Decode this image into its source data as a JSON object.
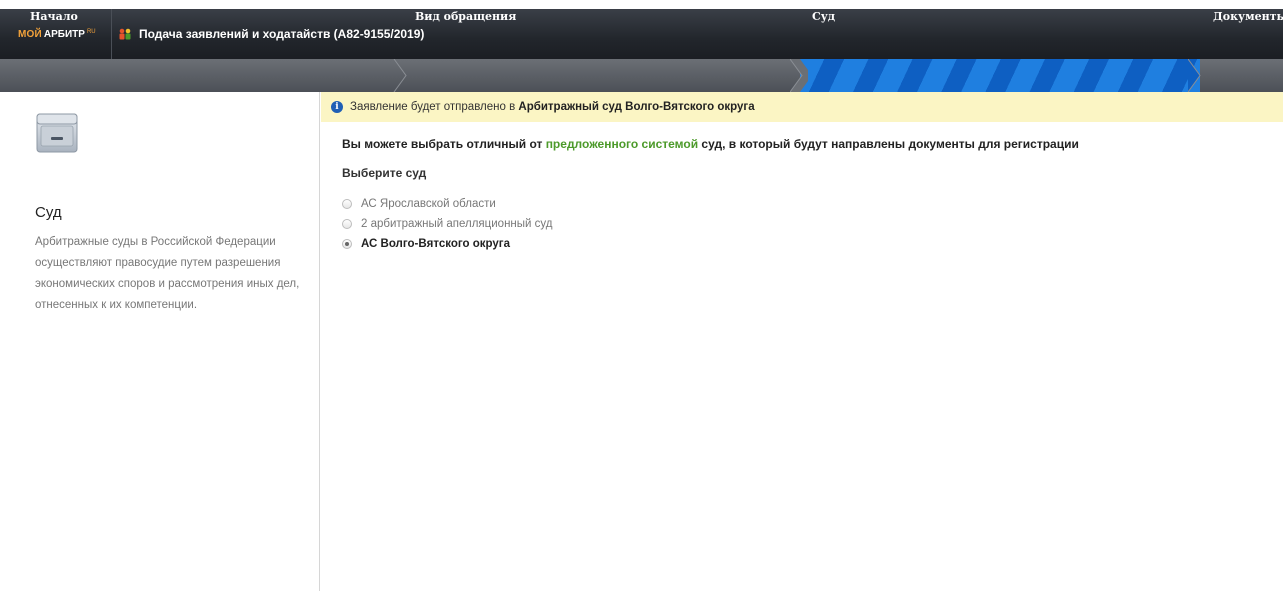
{
  "header": {
    "logo_part1": "МОЙ",
    "logo_part2": "АРБИТР",
    "logo_part3": "RU",
    "title": "Подача заявлений и ходатайств  (А82-9155/2019)",
    "title_icon": "people-icon"
  },
  "steps": [
    {
      "label": "Начало",
      "active": false
    },
    {
      "label": "Вид обращения",
      "active": false
    },
    {
      "label": "Суд",
      "active": true
    },
    {
      "label": "Документы",
      "active": false
    }
  ],
  "sidebar": {
    "icon": "printer-icon",
    "title": "Суд",
    "description": "Арбитражные суды в Российской Федерации осуществляют правосудие путем разрешения экономических споров и рассмотрения иных дел, отнесенных к их компетенции."
  },
  "notice": {
    "icon": "info-icon",
    "text_prefix": "Заявление будет отправлено в ",
    "court_name": "Арбитражный суд Волго-Вятского округа"
  },
  "main": {
    "intro_part1": "Вы можете выбрать отличный от ",
    "intro_link": "предложенного системой",
    "intro_part2": " суд, в который будут направлены документы для регистрации",
    "choose_label": "Выберите суд",
    "options": [
      {
        "label": "АС Ярославской области",
        "checked": false
      },
      {
        "label": "2 арбитражный апелляционный суд",
        "checked": false
      },
      {
        "label": "АС Волго-Вятского округа",
        "checked": true
      }
    ]
  },
  "colors": {
    "accent_blue": "#1f7fe0",
    "link_green": "#4c9a2a",
    "notice_bg": "#fbf5c4",
    "logo_orange": "#f2a23a"
  }
}
